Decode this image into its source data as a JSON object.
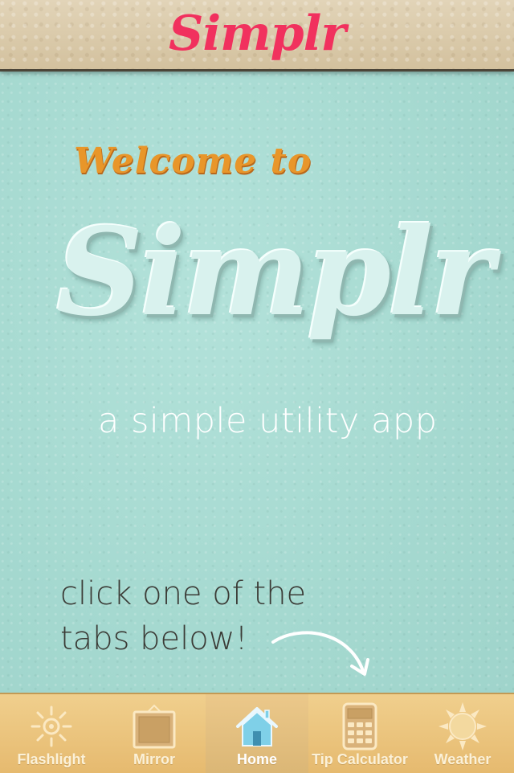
{
  "header": {
    "title": "Simplr"
  },
  "main": {
    "welcome": "Welcome to",
    "hero_title": "Simplr",
    "subtitle": "a simple utility app",
    "hint_line1": "click one of the",
    "hint_line2": "tabs below!"
  },
  "tabs": [
    {
      "label": "Flashlight",
      "icon": "sun-burst-icon",
      "active": false
    },
    {
      "label": "Mirror",
      "icon": "mirror-frame-icon",
      "active": false
    },
    {
      "label": "Home",
      "icon": "home-icon",
      "active": true
    },
    {
      "label": "Tip Calculator",
      "icon": "calculator-icon",
      "active": false
    },
    {
      "label": "Weather",
      "icon": "sun-icon",
      "active": false
    }
  ],
  "colors": {
    "header_title": "#f1315e",
    "welcome": "#e8962a",
    "background": "#a9dcd4",
    "tabbar": "#e6ba6f",
    "active_icon": "#7fd0e8"
  }
}
